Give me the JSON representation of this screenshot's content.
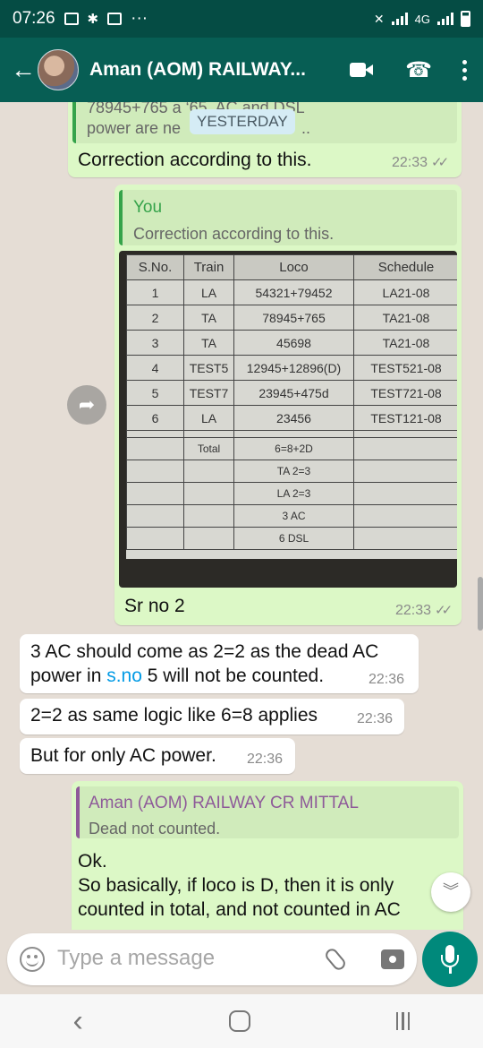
{
  "status_bar": {
    "time": "07:26",
    "network": "4G",
    "more": "···"
  },
  "header": {
    "back": "←",
    "title": "Aman (AOM) RAILWAY...",
    "call_icon": "☎"
  },
  "messages": {
    "m1": {
      "quote_text_line1": "78945+765 a          ‘65. AC and DSL",
      "quote_text_line2": "power are ne",
      "quote_text_tail": "..",
      "date_chip": "YESTERDAY",
      "text": "Correction according to this.",
      "time": "22:33",
      "ticks": "✓✓"
    },
    "m2": {
      "quote_author": "You",
      "quote_text": "Correction according to this.",
      "caption": "Sr no 2",
      "time": "22:33",
      "ticks": "✓✓"
    },
    "m3": {
      "line1": "3 AC should come as 2=2 as the dead AC",
      "line2_pre": "power in ",
      "line2_link": "s.no",
      "line2_post": " 5 will not be counted.",
      "time": "22:36"
    },
    "m4": {
      "text": "2=2 as same logic like 6=8 applies",
      "time": "22:36"
    },
    "m5": {
      "text": "But for only AC power.",
      "time": "22:36"
    },
    "m6": {
      "quote_author": "Aman (AOM) RAILWAY CR MITTAL",
      "quote_text": "Dead not counted.",
      "line1": "Ok.",
      "line2": "So basically, if loco is D, then it is only",
      "line3": "counted in total, and not counted in AC"
    }
  },
  "photo_table": {
    "headers": [
      "S.No.",
      "Train",
      "Loco",
      "Schedule"
    ],
    "rows": [
      [
        "1",
        "LA",
        "54321+79452",
        "LA21-08"
      ],
      [
        "2",
        "TA",
        "78945+765",
        "TA21-08"
      ],
      [
        "3",
        "TA",
        "45698",
        "TA21-08"
      ],
      [
        "4",
        "TEST5",
        "12945+12896(D)",
        "TEST521-08"
      ],
      [
        "5",
        "TEST7",
        "23945+475d",
        "TEST721-08"
      ],
      [
        "6",
        "LA",
        "23456",
        "TEST121-08"
      ]
    ],
    "summary_label": "Total",
    "summary": [
      "6=8+2D",
      "TA 2=3",
      "LA 2=3",
      "3 AC",
      "6 DSL"
    ]
  },
  "composer": {
    "placeholder": "Type a message"
  },
  "icons": {
    "forward": "forward-icon",
    "scroll_down": "chevron-double-down-icon",
    "emoji": "emoji-icon",
    "attach": "paperclip-icon",
    "camera": "camera-icon",
    "mic": "mic-icon"
  },
  "colors": {
    "header": "#075e54",
    "status_bar": "#054c44",
    "outgoing": "#dcf8c6",
    "incoming": "#ffffff",
    "mic": "#00897b"
  }
}
